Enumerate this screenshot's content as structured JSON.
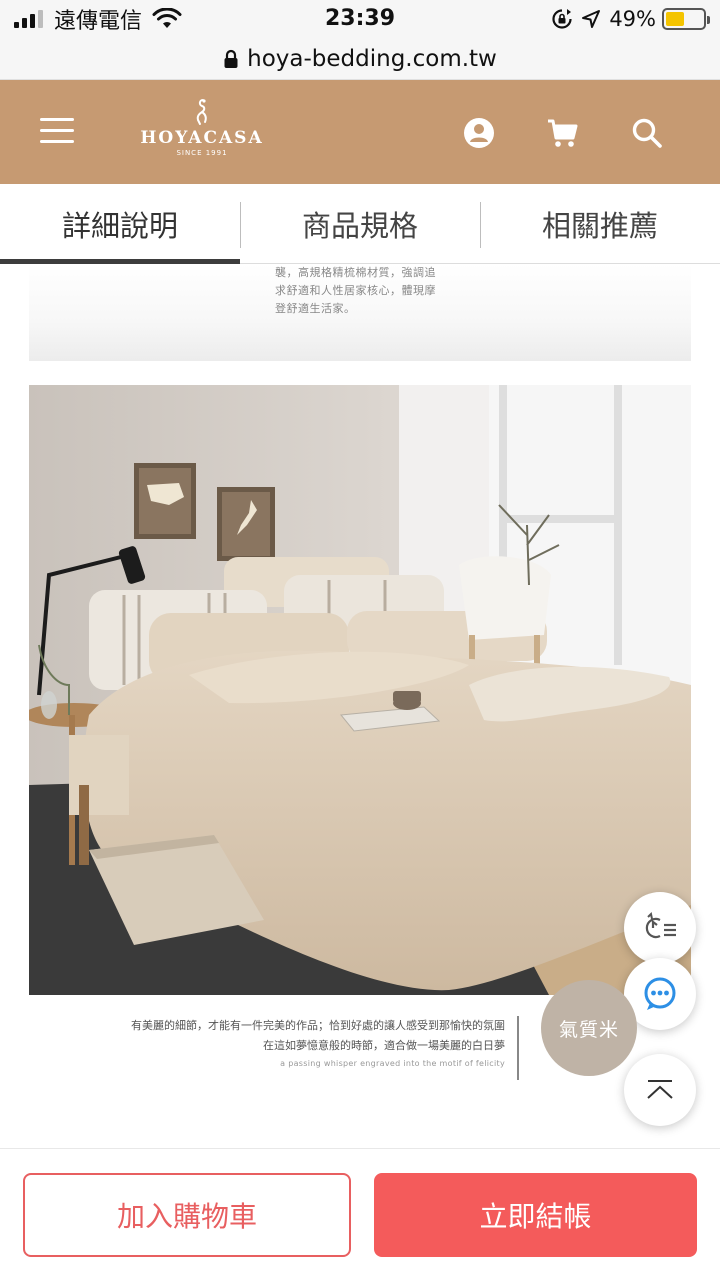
{
  "status_bar": {
    "carrier": "遠傳電信",
    "time": "23:39",
    "battery": "49%",
    "battery_level": 0.49,
    "icons": [
      "signal-icon",
      "wifi-icon",
      "orientation-lock-icon",
      "location-icon",
      "battery-icon"
    ]
  },
  "browser": {
    "url": "hoya-bedding.com.tw",
    "icons": [
      "lock-icon"
    ]
  },
  "header": {
    "brand": "HOYACASA",
    "since": "SINCE 1991",
    "icons": [
      "menu-icon",
      "crane-logo-icon",
      "user-icon",
      "cart-icon",
      "search-icon"
    ],
    "colors": {
      "background": "#c69a72",
      "foreground": "#ffffff"
    }
  },
  "tabs": [
    {
      "label": "詳細說明",
      "active": true
    },
    {
      "label": "商品規格",
      "active": false
    },
    {
      "label": "相關推薦",
      "active": false
    }
  ],
  "content": {
    "intro_lines": [
      "襲，高規格精梳棉材質，強調追",
      "求舒適和人性居家核心，體現摩",
      "登舒適生活家。"
    ],
    "caption_lines": [
      "有美麗的細節，才能有一件完美的作品；恰到好處的讓人感受到那愉快的氛圍",
      "在這如夢憶意般的時節，適合做一場美麗的白日夢"
    ],
    "caption_en": "a passing whisper engraved into the motif of felicity"
  },
  "floating": {
    "color_name": "氣質米",
    "color_swatch": "#bfb3a6",
    "icons": [
      "history-list-icon",
      "chat-icon",
      "back-to-top-icon"
    ]
  },
  "actions": {
    "add_to_cart": "加入購物車",
    "checkout": "立即結帳",
    "colors": {
      "primary": "#f45b5b",
      "outline": "#e85f60"
    }
  }
}
